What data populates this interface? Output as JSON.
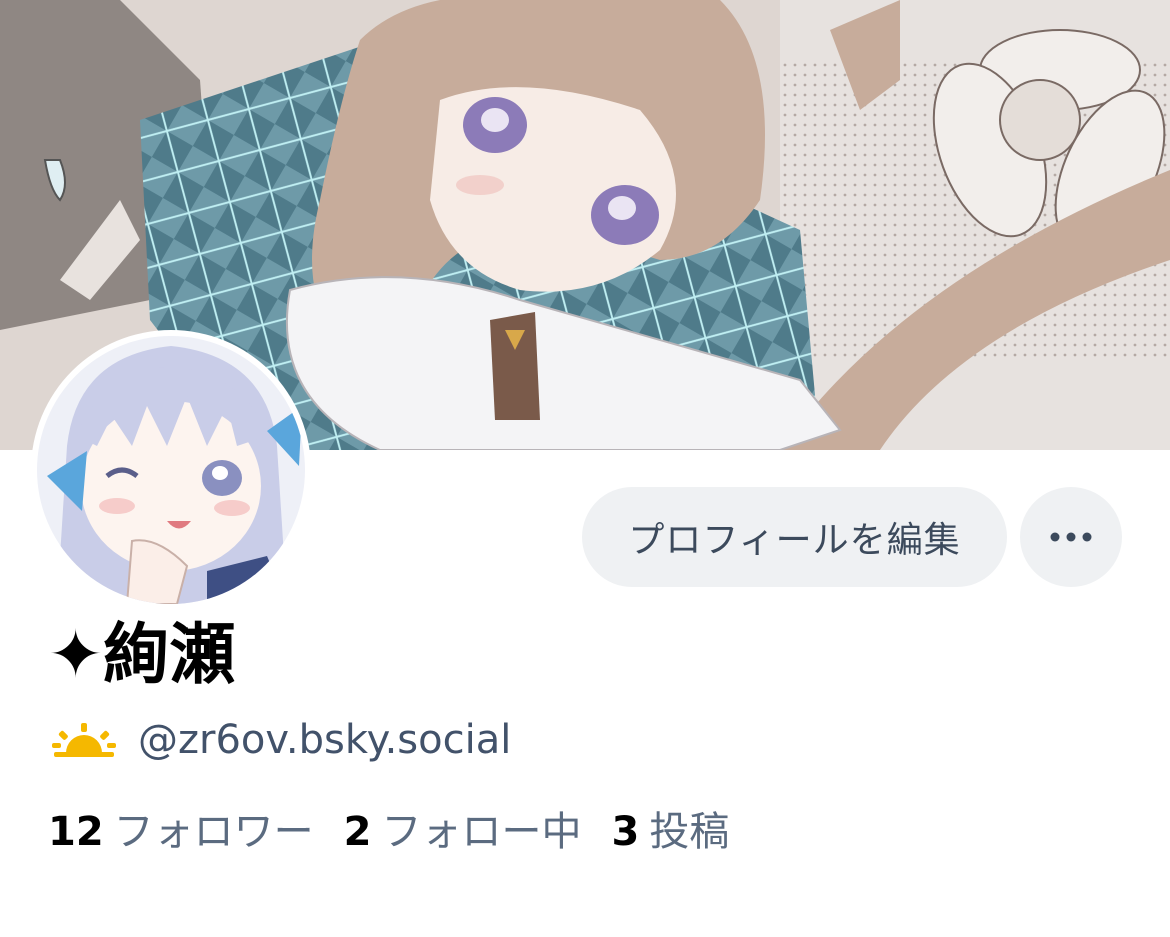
{
  "profile": {
    "display_name": "✦絢瀬",
    "handle": "@zr6ov.bsky.social",
    "handle_emoji": "sunrise-emoji",
    "edit_profile_label": "プロフィールを編集",
    "more_label": "···"
  },
  "stats": {
    "followers_count": "12",
    "followers_label": "フォロワー",
    "following_count": "2",
    "following_label": "フォロー中",
    "posts_count": "3",
    "posts_label": "投稿"
  },
  "colors": {
    "button_bg": "#eff1f3",
    "secondary_text": "#42526a",
    "accent_sun": "#f5b800"
  }
}
